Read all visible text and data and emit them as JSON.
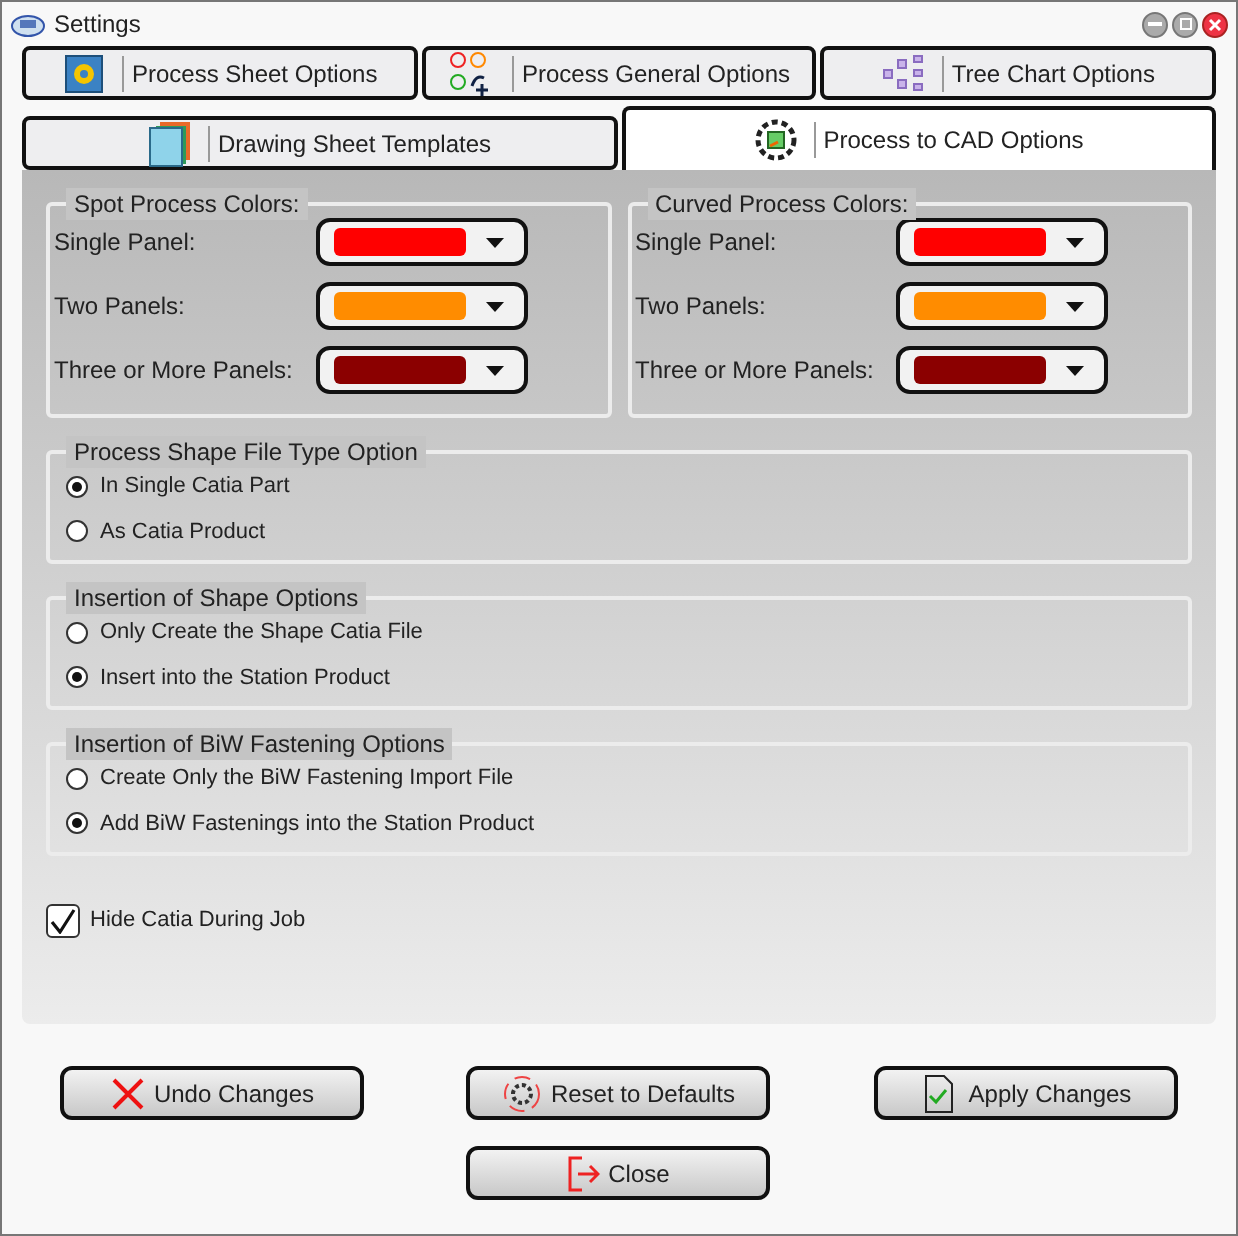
{
  "window": {
    "title": "Settings"
  },
  "tab_rows": [
    [
      {
        "label": "Process Sheet Options",
        "selected": false
      },
      {
        "label": "Process General Options",
        "selected": false
      },
      {
        "label": "Tree Chart Options",
        "selected": false
      }
    ],
    [
      {
        "label": "Drawing Sheet Templates",
        "selected": false
      },
      {
        "label": "Process to CAD Options",
        "selected": true
      }
    ]
  ],
  "color_groups": [
    {
      "title": "Spot Process Colors:",
      "rows": [
        {
          "label": "Single Panel:",
          "color": "#ff0000"
        },
        {
          "label": "Two Panels:",
          "color": "#ff8c00"
        },
        {
          "label": "Three or More Panels:",
          "color": "#8b0000"
        }
      ]
    },
    {
      "title": "Curved Process Colors:",
      "rows": [
        {
          "label": "Single Panel:",
          "color": "#ff0000"
        },
        {
          "label": "Two Panels:",
          "color": "#ff8c00"
        },
        {
          "label": "Three or More Panels:",
          "color": "#8b0000"
        }
      ]
    }
  ],
  "option_groups": [
    {
      "title": "Process Shape File Type Option",
      "options": [
        {
          "label": "In Single Catia Part",
          "selected": true
        },
        {
          "label": "As Catia Product",
          "selected": false
        }
      ]
    },
    {
      "title": "Insertion of Shape Options",
      "options": [
        {
          "label": "Only Create the Shape Catia File",
          "selected": false
        },
        {
          "label": "Insert into the Station Product",
          "selected": true
        }
      ]
    },
    {
      "title": "Insertion of BiW Fastening Options",
      "options": [
        {
          "label": "Create Only the BiW Fastening Import File",
          "selected": false
        },
        {
          "label": "Add BiW Fastenings into the Station Product",
          "selected": true
        }
      ]
    }
  ],
  "hide_catia": {
    "label": "Hide Catia During Job",
    "checked": true
  },
  "buttons": [
    {
      "label": "Undo Changes",
      "kind": "undo"
    },
    {
      "label": "Reset to Defaults",
      "kind": "reset"
    },
    {
      "label": "Apply Changes",
      "kind": "apply"
    },
    {
      "label": "Close",
      "kind": "close"
    }
  ]
}
